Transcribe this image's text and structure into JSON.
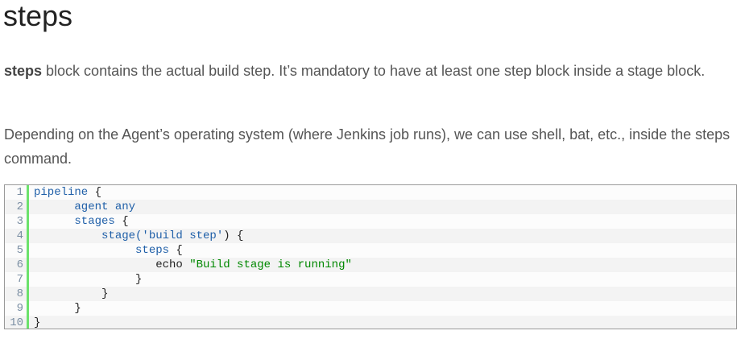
{
  "heading": "steps",
  "para1": {
    "bold": "steps",
    "rest": " block contains the actual build step. It’s mandatory to have at least one step block inside a stage block."
  },
  "para2": "Depending on the Agent’s operating system (where Jenkins job runs), we can use shell, bat, etc., inside the steps command.",
  "code": {
    "lines": [
      {
        "num": "1",
        "parts": [
          {
            "t": "pipeline",
            "c": "kw"
          },
          {
            "t": " {",
            "c": "plain"
          }
        ]
      },
      {
        "num": "2",
        "parts": [
          {
            "t": "      agent any",
            "c": "kw"
          }
        ]
      },
      {
        "num": "3",
        "parts": [
          {
            "t": "      stages",
            "c": "kw"
          },
          {
            "t": " {",
            "c": "plain"
          }
        ]
      },
      {
        "num": "4",
        "parts": [
          {
            "t": "          stage(",
            "c": "kw"
          },
          {
            "t": "'build step'",
            "c": "kw"
          },
          {
            "t": ") {",
            "c": "plain"
          }
        ]
      },
      {
        "num": "5",
        "parts": [
          {
            "t": "               steps",
            "c": "kw"
          },
          {
            "t": " {",
            "c": "plain"
          }
        ]
      },
      {
        "num": "6",
        "parts": [
          {
            "t": "                  echo ",
            "c": "plain"
          },
          {
            "t": "\"Build stage is running\"",
            "c": "str"
          }
        ]
      },
      {
        "num": "7",
        "parts": [
          {
            "t": "               }",
            "c": "plain"
          }
        ]
      },
      {
        "num": "8",
        "parts": [
          {
            "t": "          }",
            "c": "plain"
          }
        ]
      },
      {
        "num": "9",
        "parts": [
          {
            "t": "      }",
            "c": "plain"
          }
        ]
      },
      {
        "num": "10",
        "parts": [
          {
            "t": "}",
            "c": "plain"
          }
        ]
      }
    ]
  }
}
